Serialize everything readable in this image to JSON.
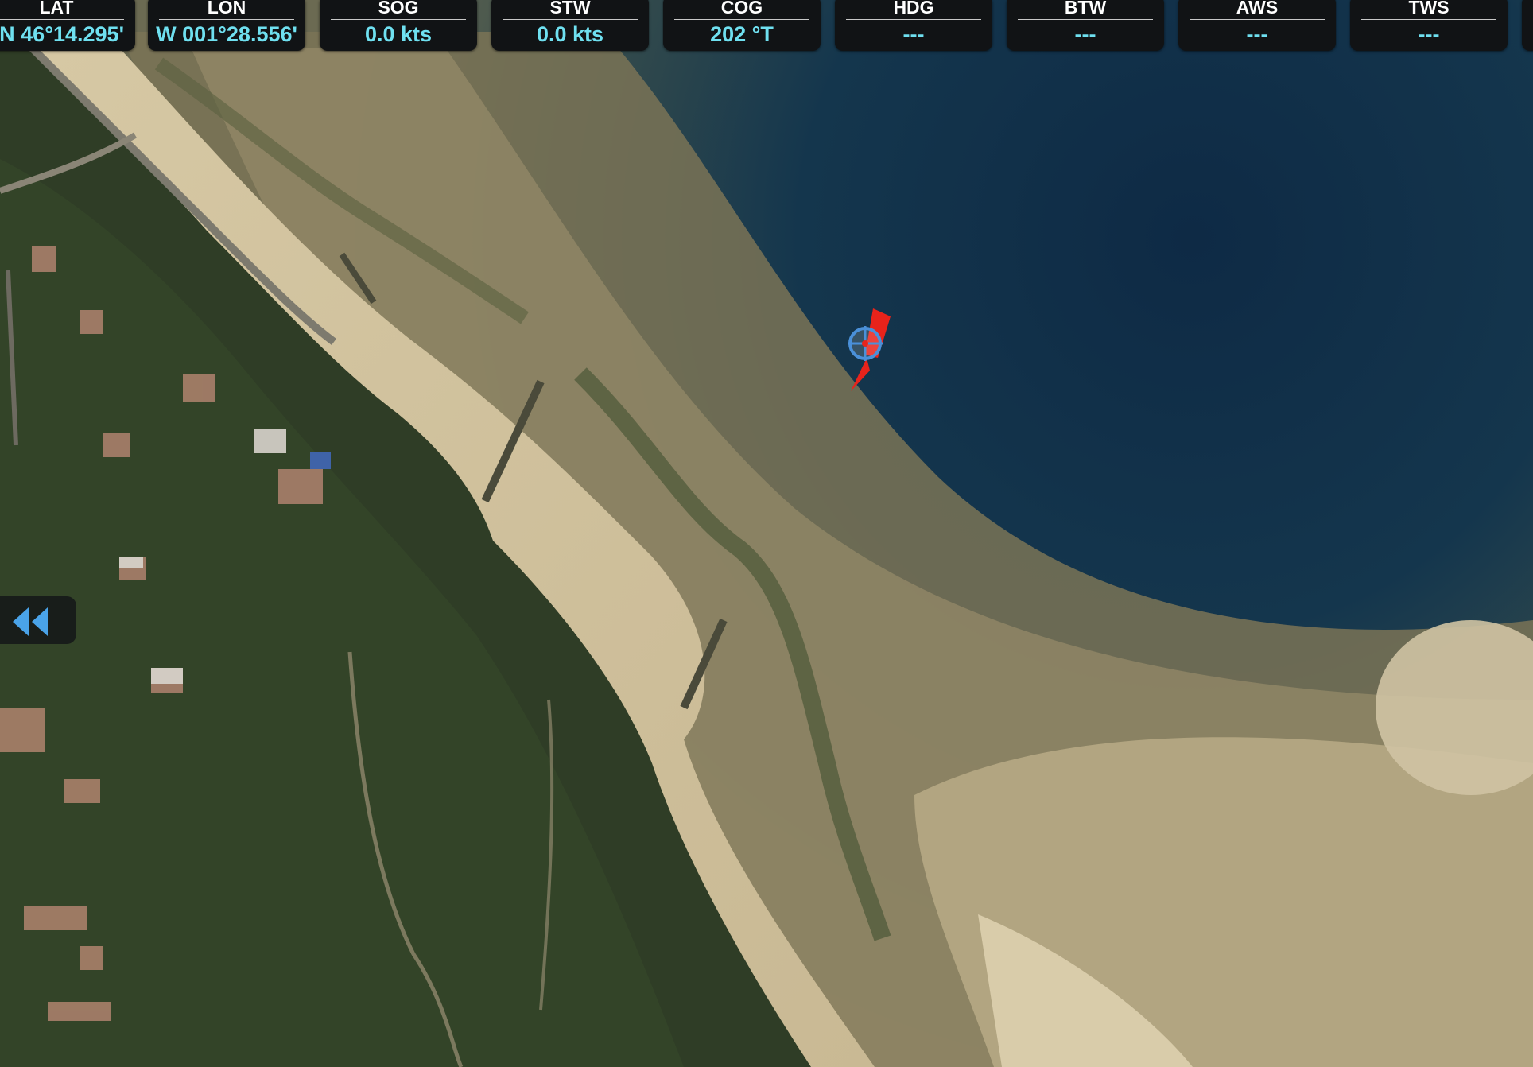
{
  "instruments": [
    {
      "label": "LAT",
      "value": "N 46°14.295'"
    },
    {
      "label": "LON",
      "value": "W 001°28.556'"
    },
    {
      "label": "SOG",
      "value": "0.0 kts"
    },
    {
      "label": "STW",
      "value": "0.0 kts"
    },
    {
      "label": "COG",
      "value": "202 °T"
    },
    {
      "label": "HDG",
      "value": "---"
    },
    {
      "label": "BTW",
      "value": "---"
    },
    {
      "label": "AWS",
      "value": "---"
    },
    {
      "label": "TWS",
      "value": "---"
    }
  ],
  "icons": {
    "collapse": "double-chevron-left-icon",
    "vessel": "vessel-position-icon",
    "cog_vector": "course-arrow-icon"
  },
  "colors": {
    "value_text": "#6fe0f0",
    "vessel": "#e8231b",
    "position_ring": "#4a90d9"
  }
}
